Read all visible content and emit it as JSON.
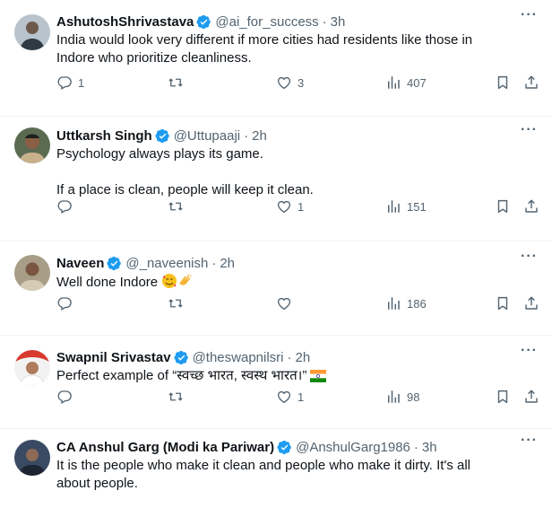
{
  "tweets": [
    {
      "name": "AshutoshShrivastava",
      "handle": "@ai_for_success",
      "time": "3h",
      "lines": [
        "India would look very different if more cities had residents like those in",
        "Indore who prioritize cleanliness."
      ],
      "replies": "1",
      "retweets": "",
      "likes": "3",
      "views": "407"
    },
    {
      "name": "Uttkarsh Singh",
      "handle": "@Uttupaaji",
      "time": "2h",
      "line1": "Psychology always plays its game.",
      "line2": "If a place is clean, people will keep it clean.",
      "replies": "",
      "retweets": "",
      "likes": "1",
      "views": "151"
    },
    {
      "name": "Naveen",
      "handle": "@_naveenish",
      "time": "2h",
      "text": "Well done Indore",
      "emoji": [
        "smiling-face-with-hearts",
        "clapping-hands"
      ],
      "replies": "",
      "retweets": "",
      "likes": "",
      "views": "186"
    },
    {
      "name": "Swapnil Srivastav",
      "handle": "@theswapnilsri",
      "time": "2h",
      "text": "Perfect example of “स्वच्छ भारत, स्वस्थ भारत।”",
      "emoji": [
        "india-flag"
      ],
      "replies": "",
      "retweets": "",
      "likes": "1",
      "views": "98"
    },
    {
      "name": "CA Anshul Garg (Modi ka Pariwar)",
      "handle": "@AnshulGarg1986",
      "time": "3h",
      "lines": [
        "It is the people who make it clean and people who make it dirty. It's all",
        "about people."
      ]
    }
  ],
  "colors": {
    "verified": "#1d9bf0",
    "muted": "#536471",
    "text": "#0f1419",
    "divider": "#eff3f4"
  },
  "icons": [
    "reply-icon",
    "retweet-icon",
    "like-icon",
    "views-icon",
    "bookmark-icon",
    "share-icon",
    "more-icon",
    "verified-badge-icon"
  ]
}
